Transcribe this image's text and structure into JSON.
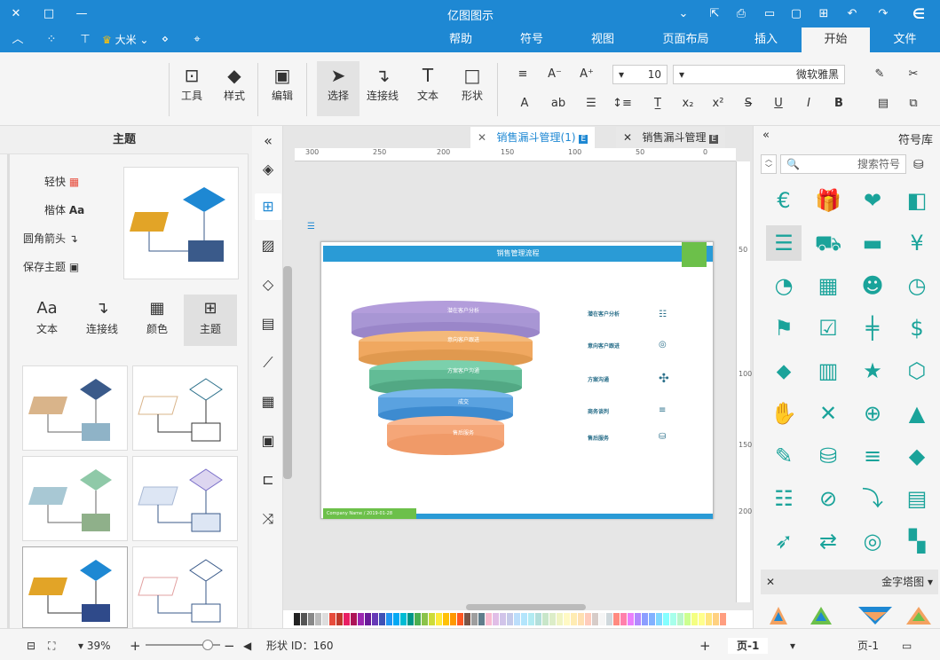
{
  "app": {
    "title": "亿图图示"
  },
  "menu": {
    "tabs": [
      {
        "label": "文件",
        "active": false
      },
      {
        "label": "开始",
        "active": true
      },
      {
        "label": "插入",
        "active": false
      },
      {
        "label": "页面布局",
        "active": false
      },
      {
        "label": "视图",
        "active": false
      },
      {
        "label": "符号",
        "active": false
      },
      {
        "label": "帮助",
        "active": false
      }
    ]
  },
  "user": {
    "name": "大米"
  },
  "ribbon": {
    "tools": [
      {
        "label": "形状",
        "icon": "□"
      },
      {
        "label": "文本",
        "icon": "T"
      },
      {
        "label": "连接线",
        "icon": "↴"
      },
      {
        "label": "选择",
        "icon": "➤"
      },
      {
        "label": "编辑",
        "icon": "▣"
      },
      {
        "label": "样式",
        "icon": "◆"
      },
      {
        "label": "工具",
        "icon": "⊡"
      }
    ],
    "font_name": "微软雅黑",
    "font_size": "10"
  },
  "theme_panel": {
    "title": "主题",
    "options": [
      "轻快",
      "楷体",
      "圆角箭头",
      "保存主题"
    ],
    "tabs": [
      "主题",
      "颜色",
      "连接线",
      "文本"
    ]
  },
  "doc_tabs": [
    {
      "label": "销售漏斗管理"
    },
    {
      "label": "销售漏斗管理(1)"
    }
  ],
  "ruler": {
    "h_ticks": [
      "300",
      "250",
      "200",
      "150",
      "100",
      "50",
      "0"
    ],
    "v_ticks": [
      "50",
      "100",
      "150",
      "200"
    ]
  },
  "slide": {
    "header": "销售管理流程",
    "funnel": [
      {
        "label": "潜在客户分析",
        "color": "#b39ddb"
      },
      {
        "label": "意向客户跟进",
        "color": "#f4a261"
      },
      {
        "label": "方案客户沟通",
        "color": "#6cc3a0"
      },
      {
        "label": "成交",
        "color": "#5aa9e6"
      },
      {
        "label": "售后服务",
        "color": "#f4a06b"
      }
    ],
    "notes": [
      "潜在客户分析",
      "意向客户跟进",
      "方案沟通",
      "商务谈判",
      "售后服务"
    ],
    "footer": "Company Name / 2019-01-28"
  },
  "symbol_panel": {
    "title": "符号库",
    "search_placeholder": "搜索符号",
    "section": "金字塔图",
    "icons": [
      "arrow-left",
      "heart-hand",
      "gift",
      "euro",
      "yen",
      "card",
      "truck",
      "list",
      "clock",
      "team",
      "briefcase",
      "wave",
      "dollar",
      "sign",
      "checkbox",
      "flag",
      "box",
      "star",
      "bar-chart",
      "tag",
      "warning",
      "target",
      "tools",
      "handshake",
      "diamond",
      "align",
      "coins",
      "edit",
      "clipboard",
      "chart-down",
      "ban",
      "list2",
      "map",
      "circle",
      "swap",
      "rocket"
    ]
  },
  "status": {
    "page": "页-1",
    "page2": "页-1",
    "shape_id": "形状 ID：160",
    "zoom": "39%"
  },
  "colors": {
    "accent": "#1e88d3",
    "symbol": "#1aa39a"
  }
}
